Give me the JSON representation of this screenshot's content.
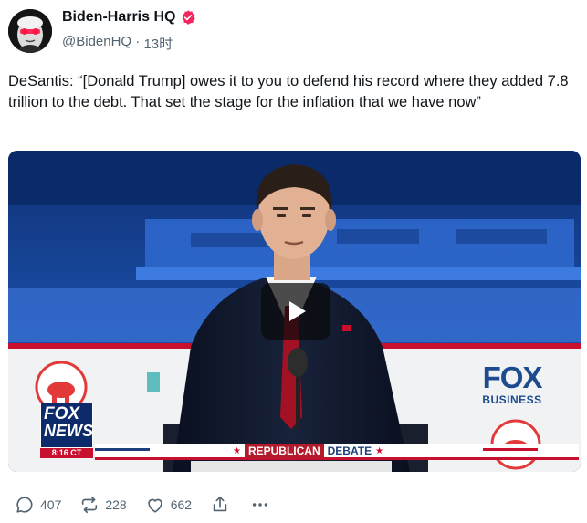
{
  "author": {
    "display_name": "Biden-Harris HQ",
    "handle": "@BidenHQ",
    "separator": " · ",
    "time": "13时",
    "verified": true,
    "verified_badge_color": "#f4245e",
    "avatar_icon": "avatar-laser-eyes"
  },
  "post": {
    "text": "DeSantis: “[Donald Trump] owes it to you to defend his record where they added 7.8 trillion to the debt. That set the stage for the inflation that we have now”"
  },
  "media": {
    "type": "video",
    "play_icon": "play-icon",
    "overlays": {
      "fox_news_top": "FOX",
      "fox_news_bottom": "NEWS",
      "clock": "8:16 CT",
      "fox_business_top": "FOX",
      "fox_business_bottom": "BUSINESS",
      "banner_republican": "REPUBLICAN",
      "banner_debate": "DEBATE",
      "banner_star": "★"
    }
  },
  "actions": {
    "reply_count": "407",
    "repost_count": "228",
    "like_count": "662",
    "icons": [
      "reply-icon",
      "repost-icon",
      "like-icon",
      "share-icon",
      "more-icon"
    ]
  },
  "colors": {
    "text_primary": "#0f1419",
    "text_secondary": "#536471",
    "fox_red": "#c8102e",
    "fox_blue": "#1d4b8f"
  }
}
